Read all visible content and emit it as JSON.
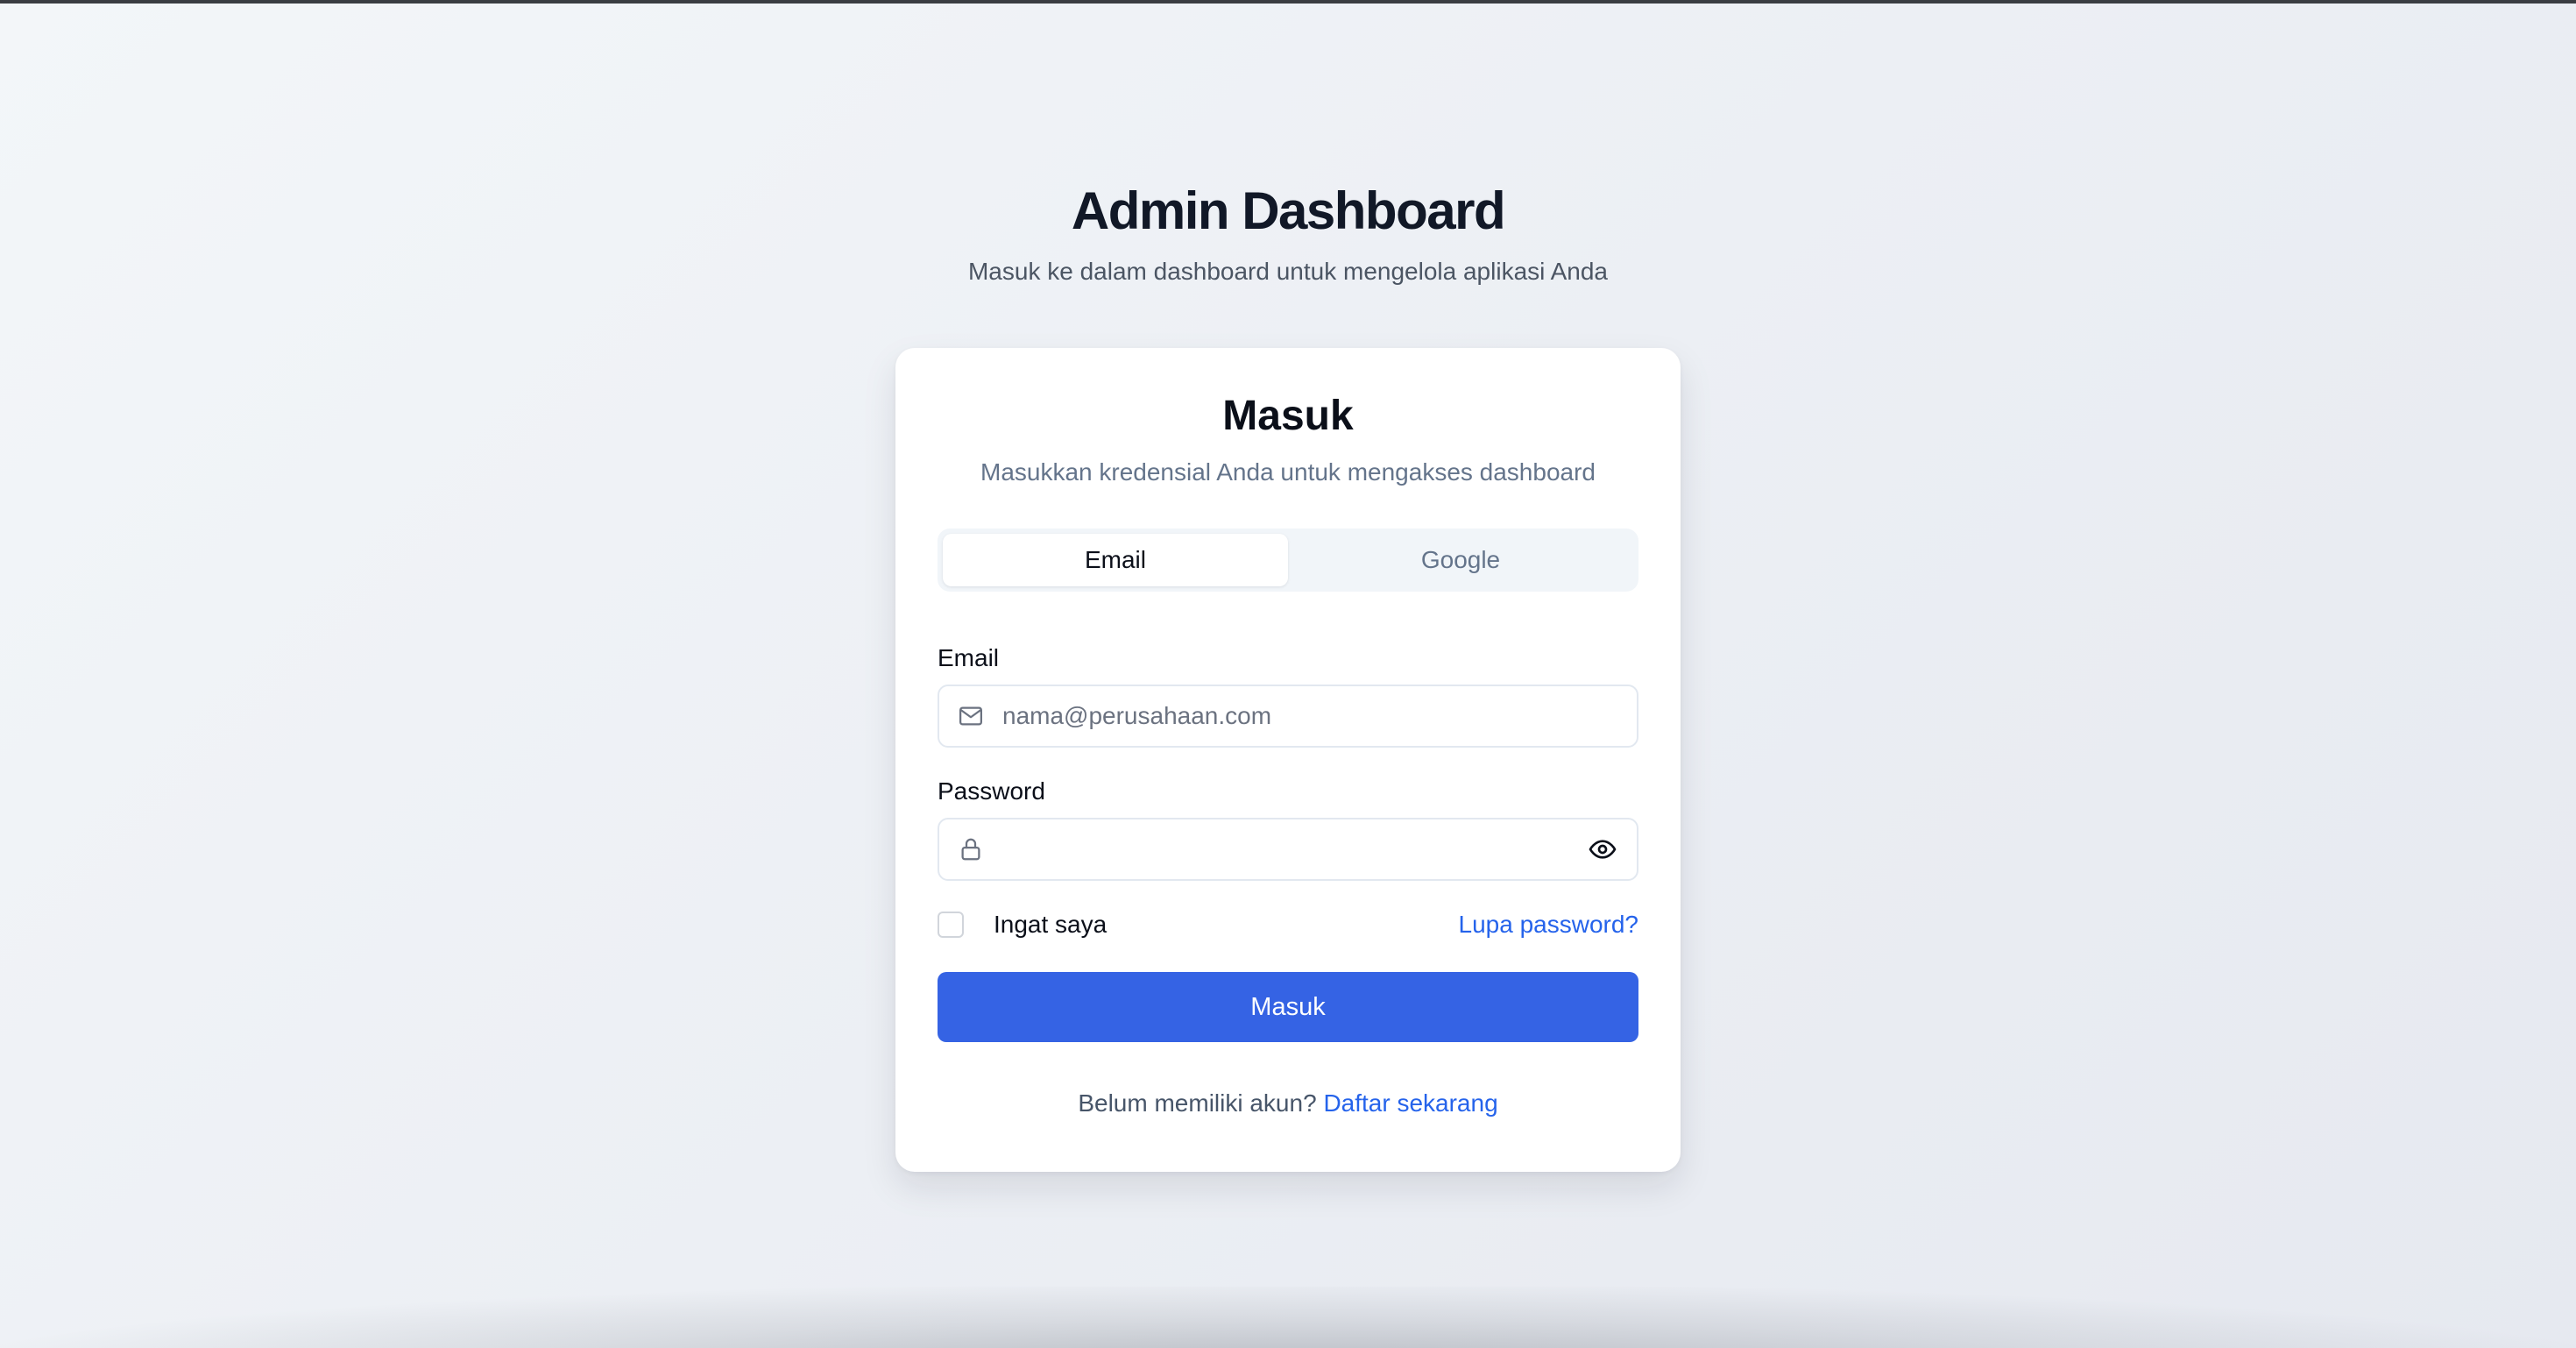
{
  "header": {
    "title": "Admin Dashboard",
    "subtitle": "Masuk ke dalam dashboard untuk mengelola aplikasi Anda"
  },
  "card": {
    "title": "Masuk",
    "subtitle": "Masukkan kredensial Anda untuk mengakses dashboard",
    "tabs": [
      {
        "label": "Email",
        "active": true
      },
      {
        "label": "Google",
        "active": false
      }
    ],
    "email": {
      "label": "Email",
      "placeholder": "nama@perusahaan.com",
      "value": "",
      "icon": "mail-icon"
    },
    "password": {
      "label": "Password",
      "placeholder": "",
      "value": "",
      "icon": "lock-icon",
      "toggle_icon": "eye-icon"
    },
    "remember": {
      "label": "Ingat saya",
      "checked": false
    },
    "forgot_label": "Lupa password?",
    "submit_label": "Masuk",
    "signup": {
      "prompt": "Belum memiliki akun?",
      "link": "Daftar sekarang"
    }
  },
  "colors": {
    "primary": "#3563e4",
    "link": "#2563eb",
    "background": "#eceff4",
    "card": "#ffffff"
  }
}
